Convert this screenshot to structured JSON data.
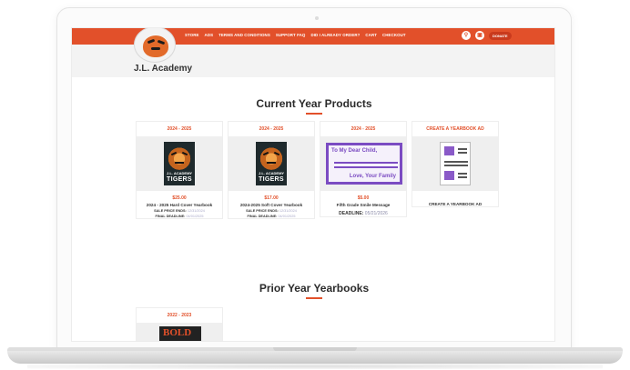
{
  "header": {
    "nav": [
      "STORE",
      "ADS",
      "TERMS AND CONDITIONS",
      "SUPPORT FAQ",
      "DID I ALREADY ORDER?",
      "CART",
      "CHECKOUT"
    ],
    "donate_label": "DONATE",
    "site_title": "J.L. Academy"
  },
  "current": {
    "title": "Current Year Products",
    "cards": [
      {
        "year": "2024 - 2025",
        "price": "$25.00",
        "name": "2024 - 2025 Hard Cover Yearbook",
        "sale_label": "SALE PRICE ENDS:",
        "sale_date": "12/31/2024",
        "final_label": "FINAL DEADLINE:",
        "final_date": "04/01/2025",
        "cover_small": "J.L. ACADEMY",
        "cover_big": "TIGERS"
      },
      {
        "year": "2024 - 2025",
        "price": "$17.00",
        "name": "2024-2025 Soft Cover Yearbook",
        "sale_label": "SALE PRICE ENDS:",
        "sale_date": "12/31/2024",
        "final_label": "FINAL DEADLINE:",
        "final_date": "04/01/2025",
        "cover_small": "J.L. ACADEMY",
        "cover_big": "TIGERS"
      },
      {
        "year": "2024 - 2025",
        "price": "$5.00",
        "name": "Fifth Grade Smile Message",
        "deadline_label": "DEADLINE:",
        "deadline_date": "05/21/2026",
        "msg_top": "To My Dear Child,",
        "msg_bottom": "Love, Your Family"
      },
      {
        "year": "CREATE A YEARBOOK AD",
        "name": "CREATE A YEARBOOK AD"
      }
    ]
  },
  "prior": {
    "title": "Prior Year Yearbooks",
    "cards": [
      {
        "year": "2022 - 2023",
        "cover_text": "BOLD"
      }
    ]
  },
  "colors": {
    "accent": "#e2502a",
    "purple": "#7b4cc2"
  }
}
